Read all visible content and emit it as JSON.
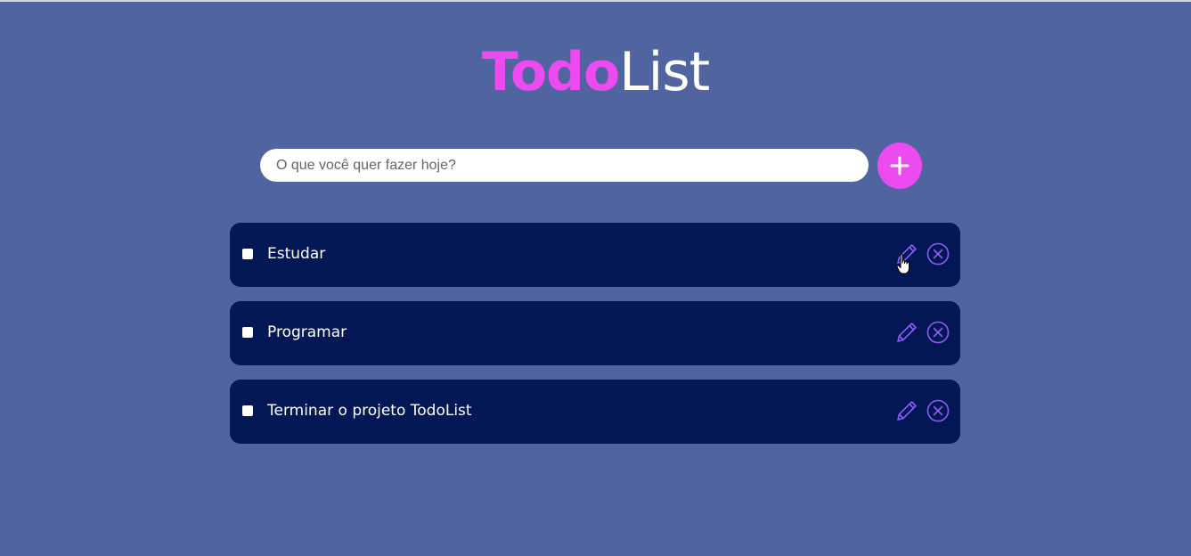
{
  "header": {
    "title_part1": "Todo",
    "title_part2": "List"
  },
  "new_task": {
    "placeholder": "O que você quer fazer hoje?",
    "value": "",
    "add_icon": "plus-icon"
  },
  "tasks": [
    {
      "label": "Estudar",
      "checked": false
    },
    {
      "label": "Programar",
      "checked": false
    },
    {
      "label": "Terminar o projeto TodoList",
      "checked": false
    }
  ],
  "icons": {
    "edit": "pencil-icon",
    "delete": "close-circle-icon",
    "cursor": "hand-pointer-icon"
  },
  "colors": {
    "background": "#5065A0",
    "accent": "#EC4BF0",
    "task_background": "#041755",
    "icon_purple": "#8B5CF6"
  }
}
